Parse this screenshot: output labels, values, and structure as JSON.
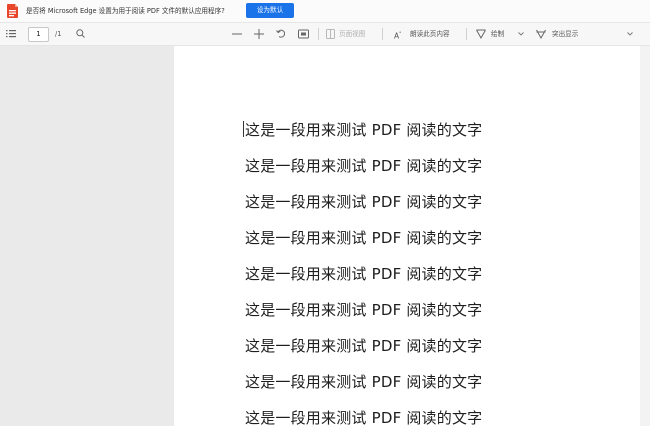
{
  "infobar": {
    "message": "是否将 Microsoft Edge 设置为用于阅读 PDF 文件的默认应用程序?",
    "default_button": "设为默认"
  },
  "toolbar": {
    "current_page": "1",
    "total_pages": "/1",
    "page_view": "页面视图",
    "read_aloud": "朗读此页内容",
    "draw": "绘制",
    "highlight": "突出显示"
  },
  "document": {
    "lines": [
      "这是一段用来测试 PDF 阅读的文字",
      "这是一段用来测试 PDF 阅读的文字",
      "这是一段用来测试 PDF 阅读的文字",
      "这是一段用来测试 PDF 阅读的文字",
      "这是一段用来测试 PDF 阅读的文字",
      "这是一段用来测试 PDF 阅读的文字",
      "这是一段用来测试 PDF 阅读的文字",
      "这是一段用来测试 PDF 阅读的文字",
      "这是一段用来测试 PDF 阅读的文字"
    ]
  },
  "colors": {
    "accent": "#1a73e8",
    "pdf_icon": "#e8462b"
  }
}
